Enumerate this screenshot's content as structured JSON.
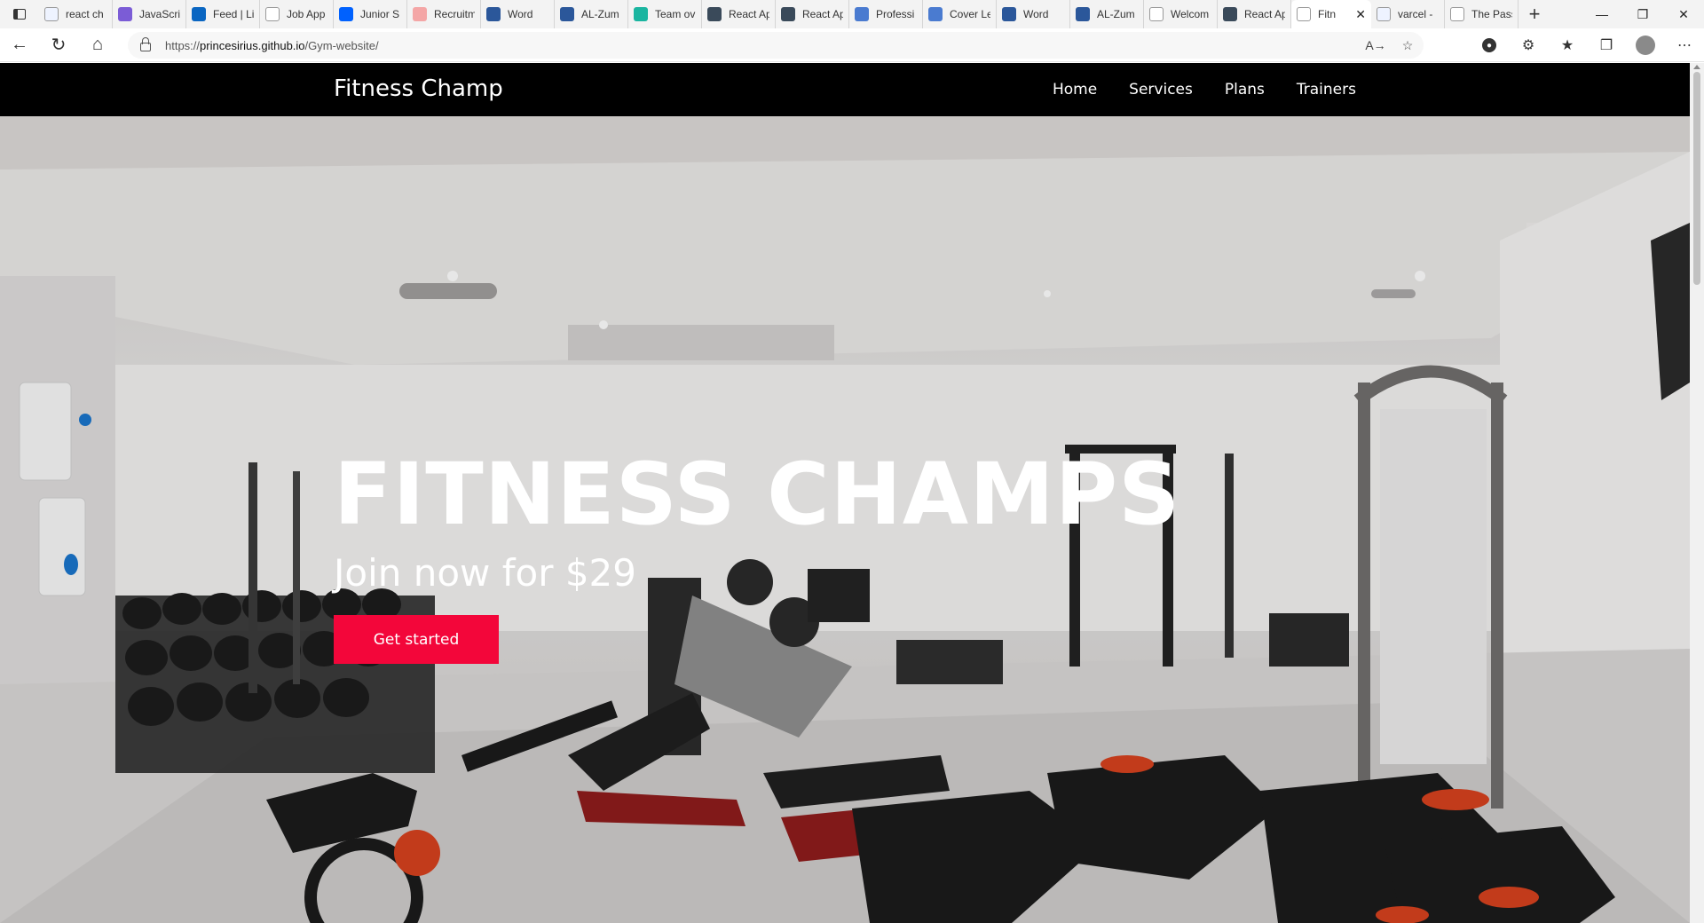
{
  "browser": {
    "tabs": [
      {
        "title": "react ch",
        "icon": "search-icon"
      },
      {
        "title": "JavaScri",
        "icon": "course-icon"
      },
      {
        "title": "Feed | Li",
        "icon": "linkedin-icon"
      },
      {
        "title": "Job App",
        "icon": "page-icon"
      },
      {
        "title": "Junior S",
        "icon": "dropbox-icon"
      },
      {
        "title": "Recruitm",
        "icon": "cloud-icon"
      },
      {
        "title": "Word",
        "icon": "word-icon"
      },
      {
        "title": "AL-Zum",
        "icon": "word-icon"
      },
      {
        "title": "Team ov",
        "icon": "diamond-icon"
      },
      {
        "title": "React Ap",
        "icon": "react-icon"
      },
      {
        "title": "React Ap",
        "icon": "react-icon"
      },
      {
        "title": "Professi",
        "icon": "docs-icon"
      },
      {
        "title": "Cover Le",
        "icon": "docs-icon"
      },
      {
        "title": "Word",
        "icon": "word-icon"
      },
      {
        "title": "AL-Zum",
        "icon": "word-icon"
      },
      {
        "title": "Welcom",
        "icon": "page-icon"
      },
      {
        "title": "React Ap",
        "icon": "react-icon"
      },
      {
        "title": "Fitn",
        "icon": "page-icon",
        "active": true
      },
      {
        "title": "varcel -",
        "icon": "search-icon"
      },
      {
        "title": "The Pass",
        "icon": "page-icon"
      }
    ],
    "url_scheme": "https://",
    "url_host": "princesirius.github.io",
    "url_path": "/Gym-website/",
    "colors": {
      "tabbar": "#f3f3f3",
      "accent": "#f3063a"
    }
  },
  "site": {
    "brand": "Fitness Champ",
    "nav": {
      "home": "Home",
      "services": "Services",
      "plans": "Plans",
      "trainers": "Trainers"
    },
    "hero": {
      "title": "FITNESS CHAMPS",
      "subtitle": "Join now for $29",
      "cta": "Get started",
      "background": "gym-interior-photo"
    }
  }
}
